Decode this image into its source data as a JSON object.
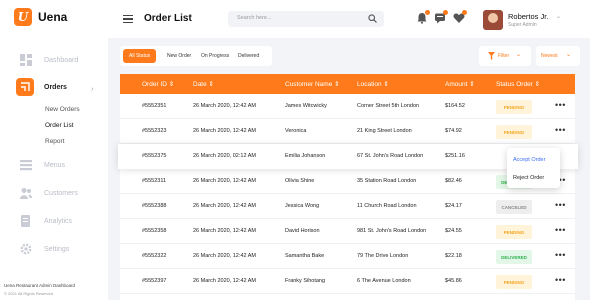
{
  "app": {
    "name": "Uena",
    "logo_letter": "U"
  },
  "sidebar": {
    "items": [
      {
        "label": "Dashboard",
        "icon": "dashboard-icon"
      },
      {
        "label": "Orders",
        "icon": "orders-icon",
        "active": true
      },
      {
        "label": "Menus",
        "icon": "menu-icon"
      },
      {
        "label": "Customers",
        "icon": "customers-icon"
      },
      {
        "label": "Analytics",
        "icon": "analytics-icon"
      },
      {
        "label": "Settings",
        "icon": "gear-icon"
      }
    ],
    "subitems": [
      {
        "label": "New Orders"
      },
      {
        "label": "Order List",
        "current": true
      },
      {
        "label": "Report"
      }
    ],
    "footer_title": "Uena Restaurant Admin Dashboard",
    "footer_copy": "© 2021 All Rights Reserved"
  },
  "header": {
    "title": "Order List",
    "search_placeholder": "Search here...",
    "user_name": "Robertos Jr.",
    "user_role": "Super Admin"
  },
  "filters": {
    "tabs": [
      "All Status",
      "New Order",
      "On Progress",
      "Delivered"
    ],
    "active_tab": "All Status",
    "filter_label": "Filter",
    "sort_label": "Newest"
  },
  "table": {
    "columns": [
      "Order ID",
      "Date",
      "Customer Name",
      "Location",
      "Amount",
      "Status Order"
    ],
    "rows": [
      {
        "id": "#5552351",
        "date": "26 March 2020, 12:42 AM",
        "customer": "James Witcwicky",
        "location": "Corner Street 5th London",
        "amount": "$164.52",
        "status": "PENDING"
      },
      {
        "id": "#5552323",
        "date": "26 March 2020, 12:42 AM",
        "customer": "Veronica",
        "location": "21 King Street London",
        "amount": "$74.92",
        "status": "PENDING"
      },
      {
        "id": "#5552375",
        "date": "26 March 2020, 02:12 AM",
        "customer": "Emilia Johanson",
        "location": "67 St. John's Road London",
        "amount": "$251.16",
        "status": ""
      },
      {
        "id": "#5552311",
        "date": "26 March 2020, 12:42 AM",
        "customer": "Olivia Shine",
        "location": "35 Station Road London",
        "amount": "$82.46",
        "status": "DELIVERED"
      },
      {
        "id": "#5552388",
        "date": "26 March 2020, 12:42 AM",
        "customer": "Jessica Wong",
        "location": "11 Church Road London",
        "amount": "$24.17",
        "status": "CANCELED"
      },
      {
        "id": "#5552358",
        "date": "26 March 2020, 12:42 AM",
        "customer": "David Horison",
        "location": "981 St. John's Road London",
        "amount": "$24.55",
        "status": "PENDING"
      },
      {
        "id": "#5552322",
        "date": "26 March 2020, 12:42 AM",
        "customer": "Samantha Bake",
        "location": "79 The Drive London",
        "amount": "$22.18",
        "status": "DELIVERED"
      },
      {
        "id": "#5552397",
        "date": "26 March 2020, 12:42 AM",
        "customer": "Franky Sihotang",
        "location": "6 The Avenue London",
        "amount": "$45.86",
        "status": "PENDING"
      }
    ]
  },
  "row_menu": {
    "accept": "Accept Order",
    "reject": "Reject Order"
  },
  "colors": {
    "accent": "#ff7a1a",
    "pending_bg": "#fff4d9",
    "pending_fg": "#f5a623",
    "delivered_bg": "#e3f7e8",
    "delivered_fg": "#2bb24c",
    "canceled_bg": "#eeeeee",
    "canceled_fg": "#888888"
  }
}
